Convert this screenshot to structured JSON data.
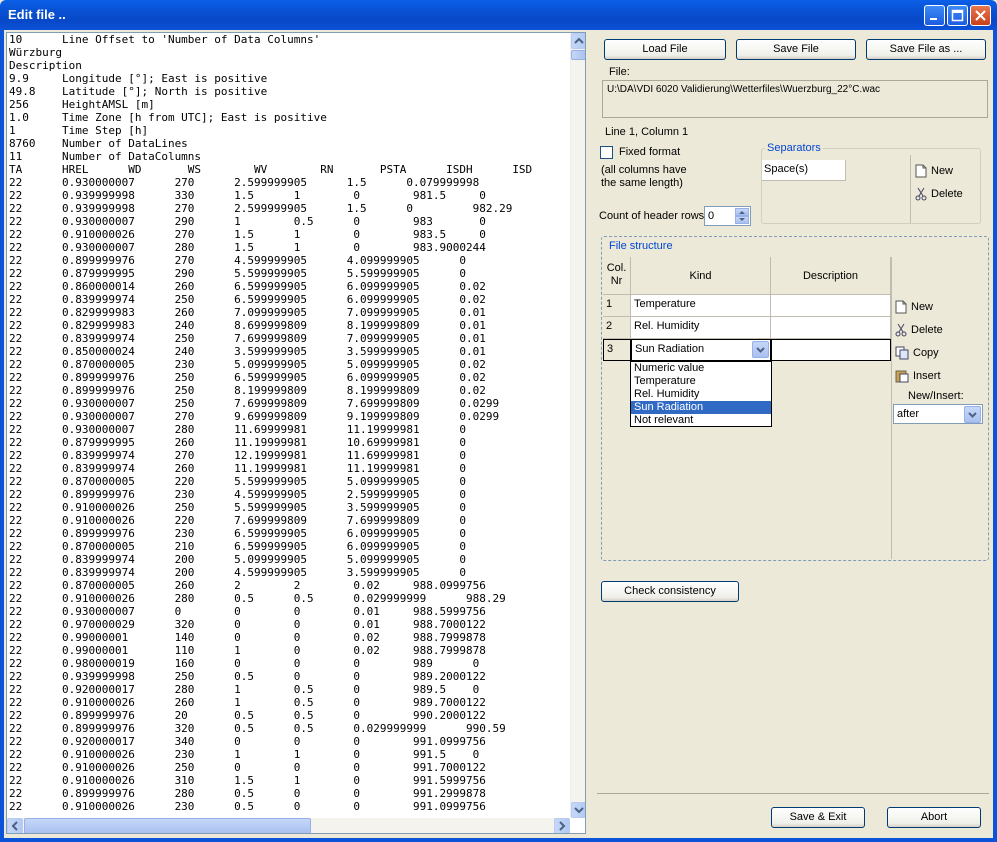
{
  "window": {
    "title": "Edit file ..",
    "minimize_icon": "minimize-icon",
    "maximize_icon": "maximize-icon",
    "close_icon": "close-icon"
  },
  "editor": {
    "lines": [
      "10      Line Offset to 'Number of Data Columns'",
      "Würzburg",
      "Description",
      "9.9     Longitude [°]; East is positive",
      "49.8    Latitude [°]; North is positive",
      "256     HeightAMSL [m]",
      "1.0     Time Zone [h from UTC]; East is positive",
      "1       Time Step [h]",
      "8760    Number of DataLines",
      "11      Number of DataColumns",
      "TA      HREL      WD       WS        WV        RN       PSTA      ISDH      ISD",
      "22      0.930000007      270      2.599999905      1.5      0.079999998",
      "22      0.939999998      330      1.5      1        0        981.5     0",
      "22      0.939999998      270      2.599999905      1.5      0         982.29",
      "22      0.930000007      290      1        0.5      0        983       0",
      "22      0.910000026      270      1.5      1        0        983.5     0",
      "22      0.930000007      280      1.5      1        0        983.9000244",
      "22      0.899999976      270      4.599999905      4.099999905      0",
      "22      0.879999995      290      5.599999905      5.599999905      0",
      "22      0.860000014      260      6.599999905      6.099999905      0.02",
      "22      0.839999974      250      6.599999905      6.099999905      0.02",
      "22      0.829999983      260      7.099999905      7.099999905      0.01",
      "22      0.829999983      240      8.699999809      8.199999809      0.01",
      "22      0.839999974      250      7.699999809      7.099999905      0.01",
      "22      0.850000024      240      3.599999905      3.599999905      0.01",
      "22      0.870000005      230      5.099999905      5.099999905      0.02",
      "22      0.899999976      250      6.599999905      6.099999905      0.02",
      "22      0.899999976      250      8.199999809      8.199999809      0.02",
      "22      0.930000007      250      7.699999809      7.699999809      0.0299",
      "22      0.930000007      270      9.699999809      9.199999809      0.0299",
      "22      0.930000007      280      11.69999981      11.19999981      0",
      "22      0.879999995      260      11.19999981      10.69999981      0",
      "22      0.839999974      270      12.19999981      11.69999981      0",
      "22      0.839999974      260      11.19999981      11.19999981      0",
      "22      0.870000005      220      5.599999905      5.099999905      0",
      "22      0.899999976      230      4.599999905      2.599999905      0",
      "22      0.910000026      250      5.599999905      3.599999905      0",
      "22      0.910000026      220      7.699999809      7.699999809      0",
      "22      0.899999976      230      6.599999905      6.099999905      0",
      "22      0.870000005      210      6.599999905      6.099999905      0",
      "22      0.839999974      200      5.099999905      5.099999905      0",
      "22      0.839999974      200      4.599999905      3.599999905      0",
      "22      0.870000005      260      2        2        0.02     988.0999756",
      "22      0.910000026      280      0.5      0.5      0.029999999      988.29",
      "22      0.930000007      0        0        0        0.01     988.5999756",
      "22      0.970000029      320      0        0        0.01     988.7000122",
      "22      0.99000001       140      0        0        0.02     988.7999878",
      "22      0.99000001       110      1        0        0.02     988.7999878",
      "22      0.980000019      160      0        0        0        989      0",
      "22      0.939999998      250      0.5      0        0        989.2000122",
      "22      0.920000017      280      1        0.5      0        989.5    0",
      "22      0.910000026      260      1        0.5      0        989.7000122",
      "22      0.899999976      20       0.5      0.5      0        990.2000122",
      "22      0.899999976      320      0.5      0.5      0.029999999      990.59",
      "22      0.920000017      340      0        0        0        991.0999756",
      "22      0.910000026      230      1        1        0        991.5    0",
      "22      0.910000026      250      0        0        0        991.7000122",
      "22      0.910000026      310      1.5      1        0        991.5999756",
      "22      0.899999976      280      0.5      0        0        991.2999878",
      "22      0.910000026      230      0.5      0        0        991.0999756"
    ]
  },
  "toolbar": {
    "load_label": "Load File",
    "save_label": "Save File",
    "save_as_label": "Save File as ..."
  },
  "file": {
    "label": "File:",
    "path": "U:\\DA\\VDI 6020 Validierung\\Wetterfiles\\Wuerzburg_22°C.wac",
    "position": "Line 1, Column 1"
  },
  "format": {
    "fixed_label": "Fixed format",
    "fixed_checked": false,
    "note": "(all columns have\nthe same length)",
    "header_rows_label": "Count of header rows",
    "header_rows_value": "0"
  },
  "separators": {
    "title": "Separators",
    "items": [
      "Space(s)"
    ],
    "new_label": "New",
    "delete_label": "Delete"
  },
  "structure": {
    "title": "File structure",
    "col_header": "Col.\nNr",
    "kind_header": "Kind",
    "desc_header": "Description",
    "rows": [
      {
        "nr": "1",
        "kind": "Temperature",
        "desc": ""
      },
      {
        "nr": "2",
        "kind": "Rel. Humidity",
        "desc": ""
      },
      {
        "nr": "3",
        "kind": "Sun Radiation",
        "desc": ""
      }
    ],
    "dropdown_options": [
      "Numeric value",
      "Temperature",
      "Rel. Humidity",
      "Sun Radiation",
      "Not relevant"
    ],
    "dropdown_selected": "Sun Radiation",
    "new_label": "New",
    "delete_label": "Delete",
    "copy_label": "Copy",
    "insert_label": "Insert",
    "new_insert_label": "New/Insert:",
    "new_insert_value": "after"
  },
  "check_label": "Check consistency",
  "save_exit_label": "Save & Exit",
  "abort_label": "Abort"
}
